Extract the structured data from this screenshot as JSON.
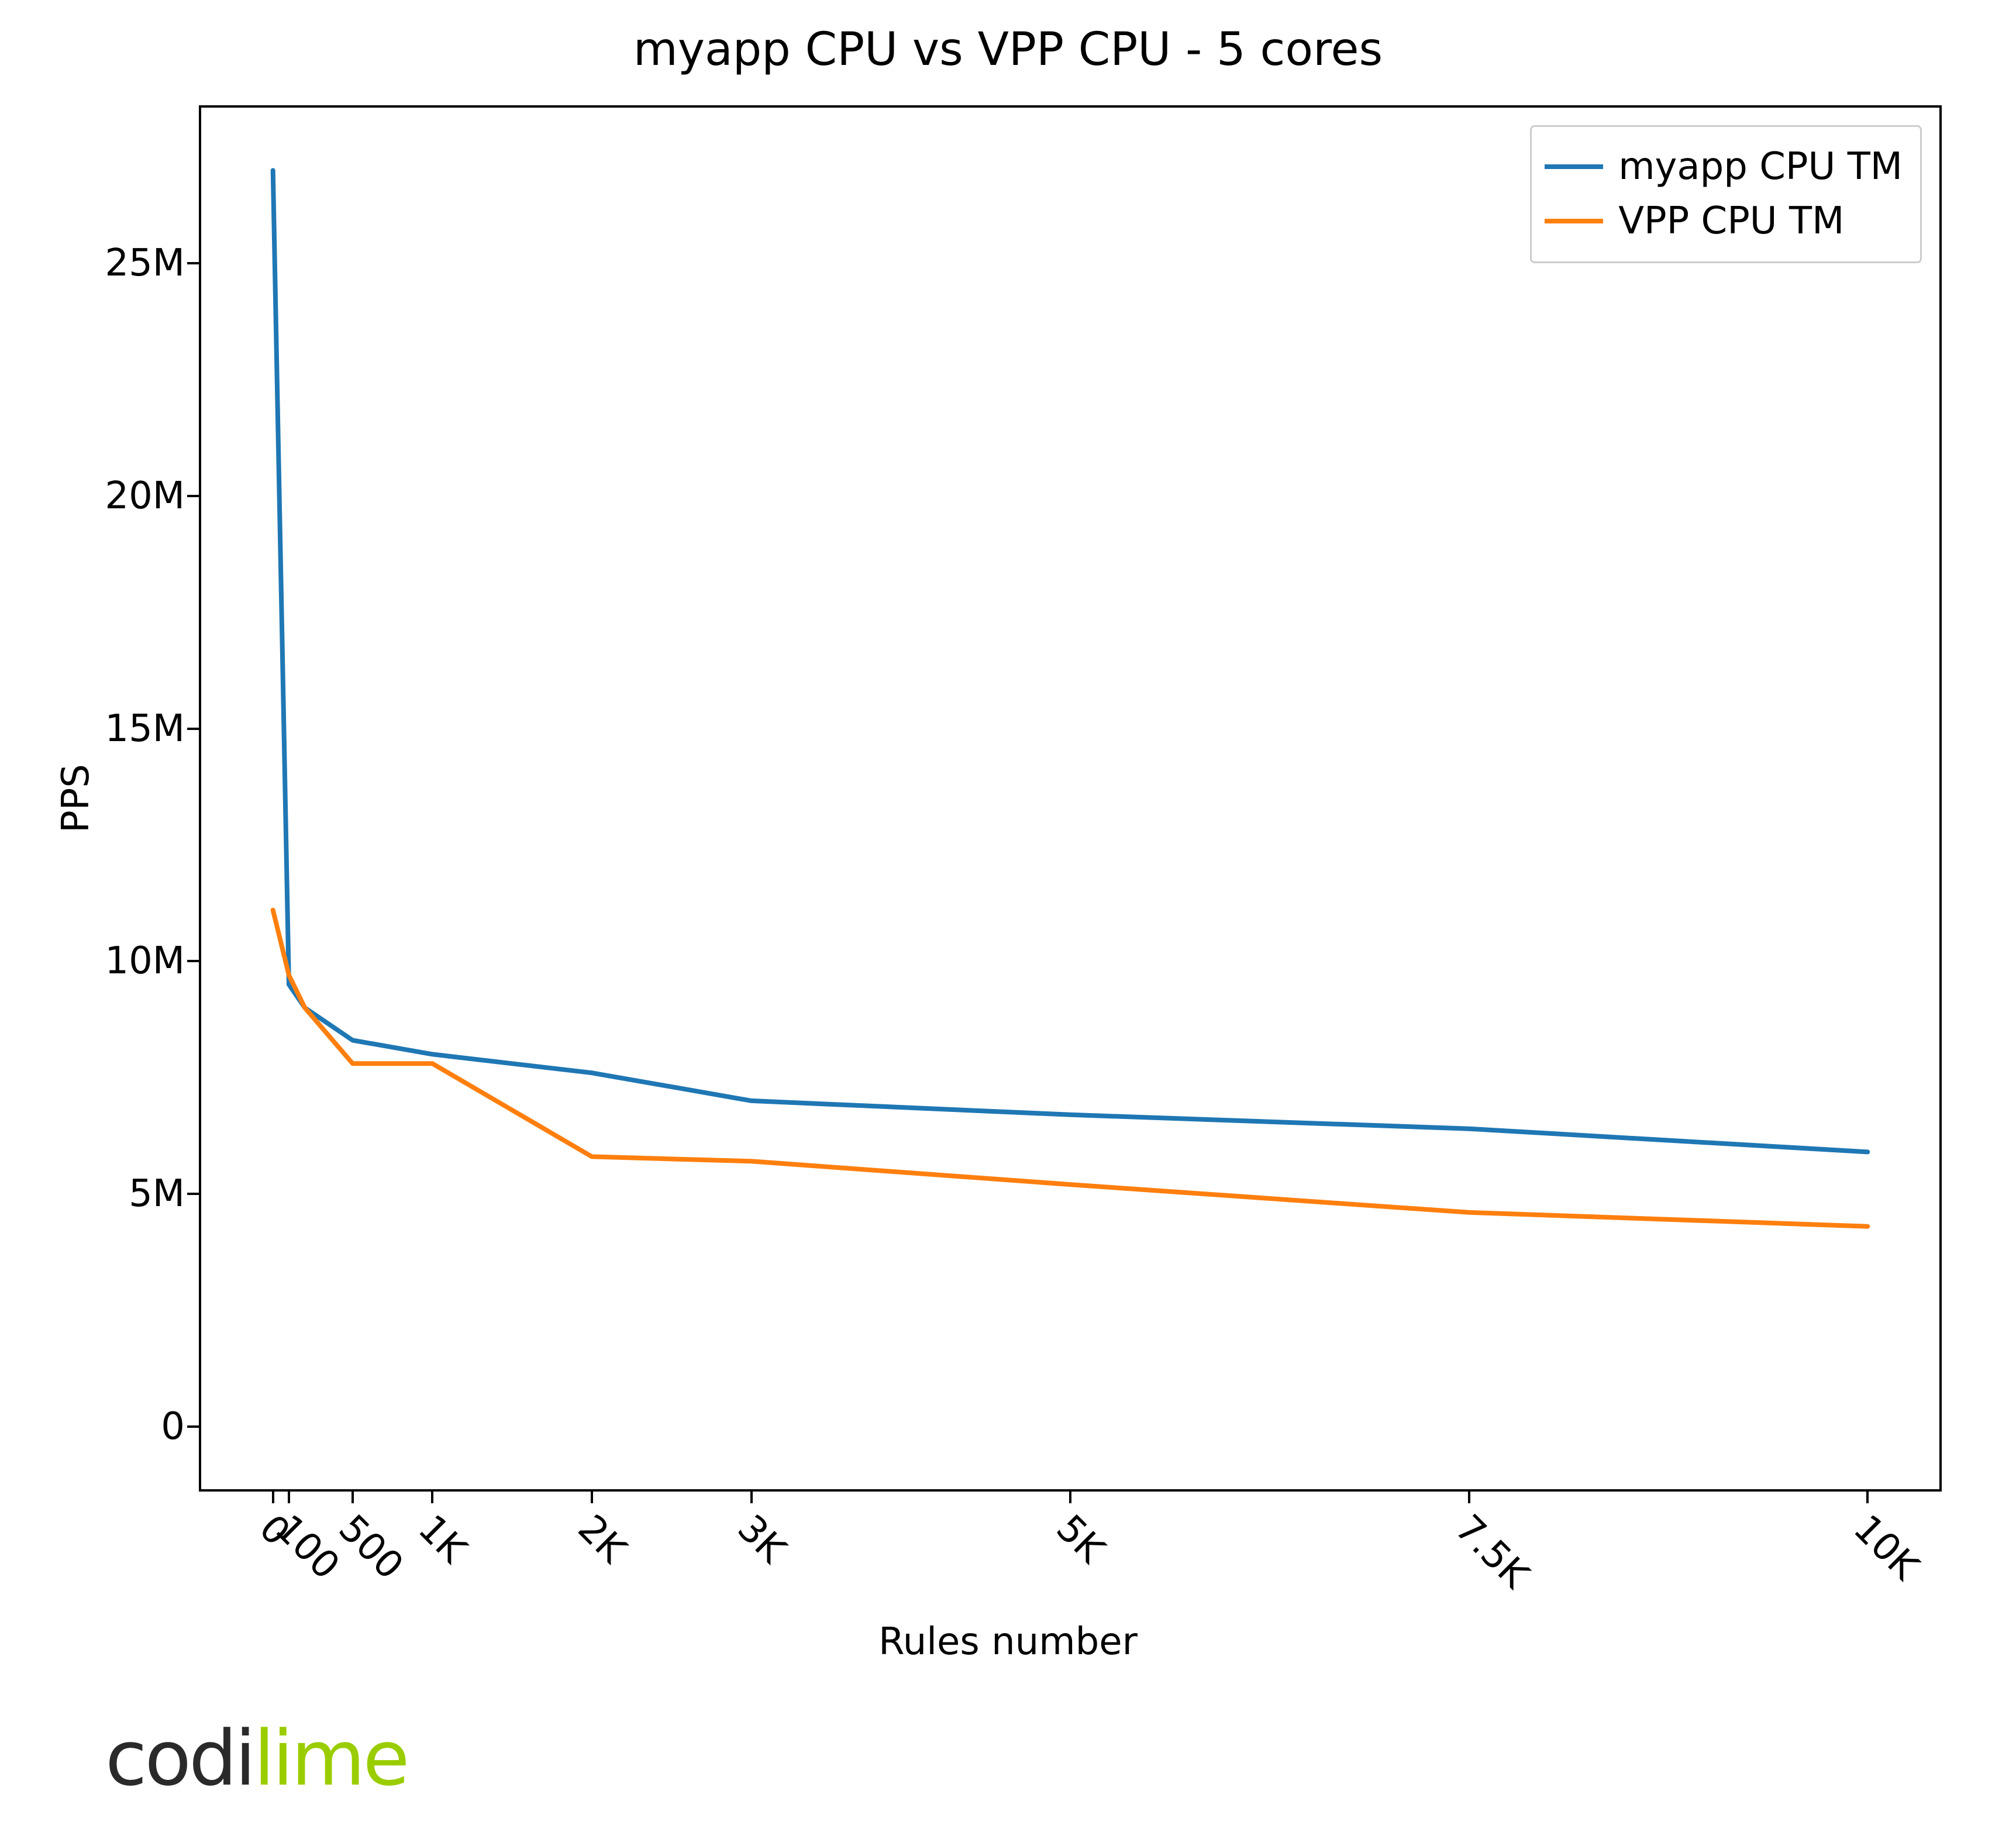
{
  "chart_data": {
    "type": "line",
    "title": "myapp CPU vs VPP CPU - 5 cores",
    "xlabel": "Rules number",
    "ylabel": "PPS",
    "x_ticks": {
      "positions": [
        0,
        100,
        500,
        1000,
        2000,
        3000,
        5000,
        7500,
        10000
      ],
      "labels": [
        "0",
        "100",
        "500",
        "1K",
        "2K",
        "3K",
        "5K",
        "7.5K",
        "10K"
      ]
    },
    "y_ticks": {
      "positions": [
        0,
        5000000,
        10000000,
        15000000,
        20000000,
        25000000
      ],
      "labels": [
        "0",
        "5M",
        "10M",
        "15M",
        "20M",
        "25M"
      ]
    },
    "xlim": [
      -450,
      10450
    ],
    "ylim": [
      -1350000,
      28350000
    ],
    "x": [
      0,
      100,
      200,
      500,
      1000,
      2000,
      3000,
      5000,
      7500,
      10000
    ],
    "series": [
      {
        "name": "myapp CPU TM",
        "color": "#1f77b4",
        "values": [
          27000000,
          9500000,
          9000000,
          8300000,
          8000000,
          7600000,
          7000000,
          6700000,
          6400000,
          5900000
        ]
      },
      {
        "name": "VPP CPU TM",
        "color": "#ff7f0e",
        "values": [
          11100000,
          9700000,
          9000000,
          7800000,
          7800000,
          5800000,
          5700000,
          5200000,
          4600000,
          4300000
        ]
      }
    ],
    "legend_pos": "upper-right"
  },
  "branding": {
    "logo_part1": "codi",
    "logo_part2": "lime"
  }
}
